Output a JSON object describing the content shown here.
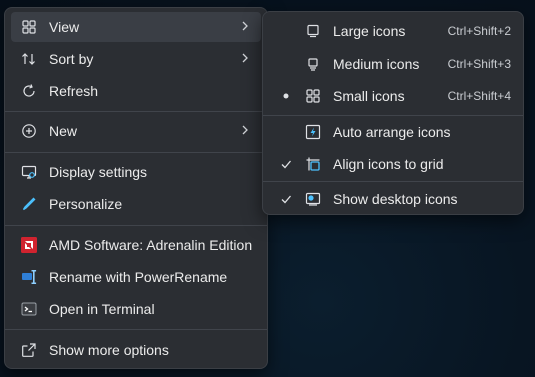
{
  "main_menu": {
    "items": [
      {
        "label": "View",
        "icon": "grid-icon",
        "submenu": true
      },
      {
        "label": "Sort by",
        "icon": "sort-icon",
        "submenu": true
      },
      {
        "label": "Refresh",
        "icon": "refresh-icon"
      },
      {
        "label": "New",
        "icon": "plus-circle-icon",
        "submenu": true
      },
      {
        "label": "Display settings",
        "icon": "monitor-icon"
      },
      {
        "label": "Personalize",
        "icon": "pen-icon"
      },
      {
        "label": "AMD Software: Adrenalin Edition",
        "icon": "amd-icon"
      },
      {
        "label": "Rename with PowerRename",
        "icon": "powerrename-icon"
      },
      {
        "label": "Open in Terminal",
        "icon": "terminal-icon"
      },
      {
        "label": "Show more options",
        "icon": "share-icon"
      }
    ]
  },
  "view_submenu": {
    "items": [
      {
        "label": "Large icons",
        "shortcut": "Ctrl+Shift+2",
        "icon": "large-icons-icon"
      },
      {
        "label": "Medium icons",
        "shortcut": "Ctrl+Shift+3",
        "icon": "medium-icons-icon"
      },
      {
        "label": "Small icons",
        "shortcut": "Ctrl+Shift+4",
        "icon": "small-icons-icon",
        "selected": true
      },
      {
        "label": "Auto arrange icons",
        "icon": "auto-arrange-icon"
      },
      {
        "label": "Align icons to grid",
        "icon": "align-grid-icon",
        "checked": true
      },
      {
        "label": "Show desktop icons",
        "icon": "desktop-icon",
        "checked": true
      }
    ]
  },
  "colors": {
    "menu_bg": "#2b2e33",
    "accent": "#4cc2ff",
    "amd_red": "#d0232f"
  }
}
